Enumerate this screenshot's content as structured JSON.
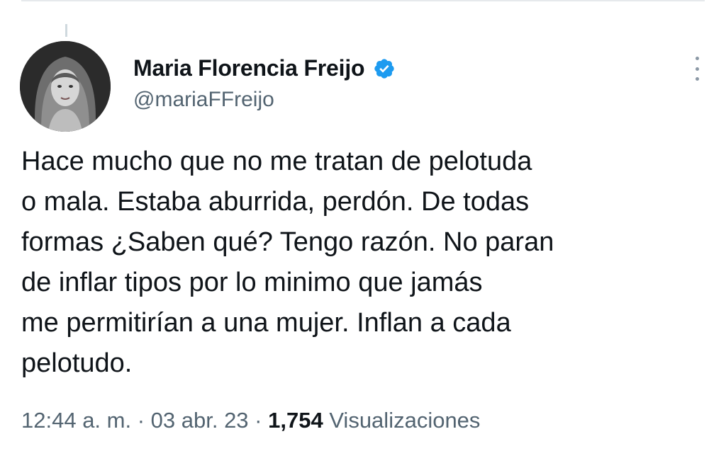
{
  "tweet": {
    "author": {
      "display_name": "Maria Florencia Freijo",
      "handle": "@mariaFFreijo",
      "verified": true,
      "verified_color": "#1d9bf0"
    },
    "text_lines": [
      "Hace mucho que no me tratan de pelotuda",
      "o mala. Estaba aburrida, perdón. De todas",
      "formas ¿Saben qué? Tengo razón. No paran",
      "de inflar tipos por lo minimo que jamás",
      "me permitirían a una mujer. Inflan a cada",
      "pelotudo."
    ],
    "meta": {
      "time": "12:44 a. m.",
      "separator": " · ",
      "date": "03 abr. 23",
      "views_count": "1,754",
      "views_label": " Visualizaciones"
    }
  },
  "icons": {
    "verified": "verified-badge-icon",
    "more": "more-options-icon"
  },
  "colors": {
    "primary_text": "#0f1419",
    "secondary_text": "#536471",
    "accent": "#1d9bf0"
  }
}
